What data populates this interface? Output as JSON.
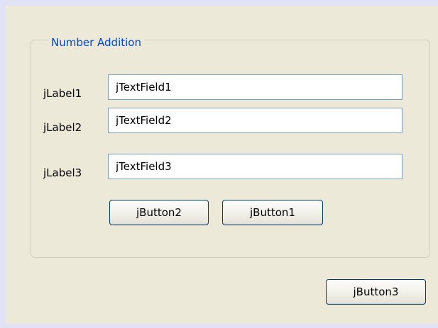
{
  "panel": {
    "group_title": "Number Addition"
  },
  "form": {
    "rows": [
      {
        "label": "jLabel1",
        "value": "jTextField1"
      },
      {
        "label": "jLabel2",
        "value": "jTextField2"
      },
      {
        "label": "jLabel3",
        "value": "jTextField3"
      }
    ]
  },
  "buttons": {
    "button2": "jButton2",
    "button1": "jButton1",
    "button3": "jButton3"
  },
  "colors": {
    "background": "#e2e2f6",
    "panel": "#ece9d8",
    "group_title": "#0046d5",
    "field_border": "#7f9db9",
    "button_border": "#003c74"
  }
}
